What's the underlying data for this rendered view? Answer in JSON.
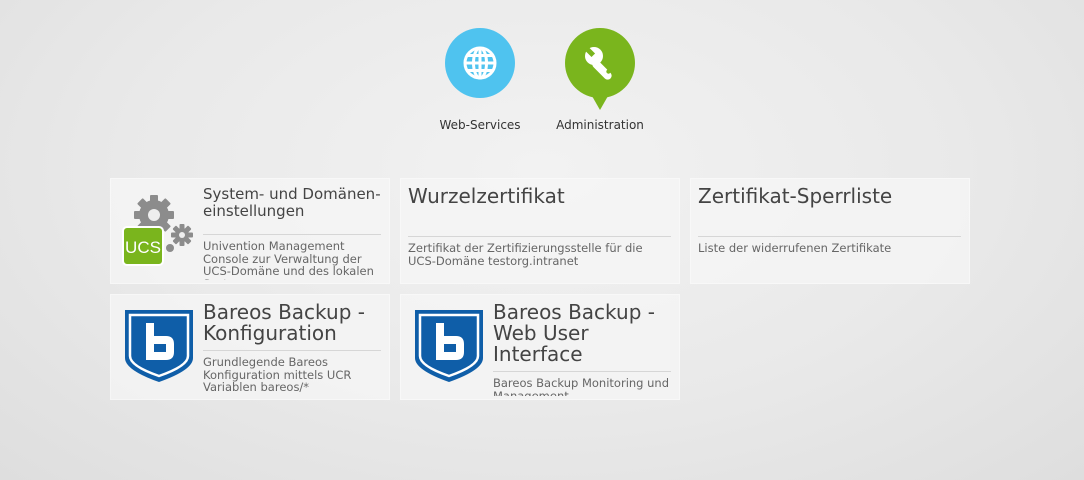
{
  "categories": [
    {
      "label": "Web-Services",
      "color": "#4fc3ef",
      "icon": "globe-icon"
    },
    {
      "label": "Administration",
      "color": "#7ab51d",
      "icon": "wrench-icon"
    }
  ],
  "tiles": [
    {
      "title": "System- und Domänen-einstellungen",
      "desc": "Univention Management Console zur Verwaltung der UCS-Domäne und des lokalen Systems",
      "icon": "ucs-gears-icon"
    },
    {
      "title": "Wurzelzertifikat",
      "desc": "Zertifikat der Zertifizierungsstelle für die UCS-Domäne testorg.intranet"
    },
    {
      "title": "Zertifikat-Sperrliste",
      "desc": "Liste der widerrufenen Zertifikate"
    },
    {
      "title": "Bareos Backup - Konfiguration",
      "desc": "Grundlegende Bareos Konfiguration mittels UCR Variablen bareos/*",
      "icon": "bareos-shield-icon"
    },
    {
      "title": "Bareos Backup - Web User Interface",
      "desc": "Bareos Backup Monitoring und Management",
      "icon": "bareos-shield-icon"
    }
  ],
  "icon_text": {
    "ucs": "UCS"
  },
  "colors": {
    "ucs_green": "#7ab51d",
    "bareos_blue": "#0f5ea8",
    "gear_gray": "#8c8c8c"
  }
}
